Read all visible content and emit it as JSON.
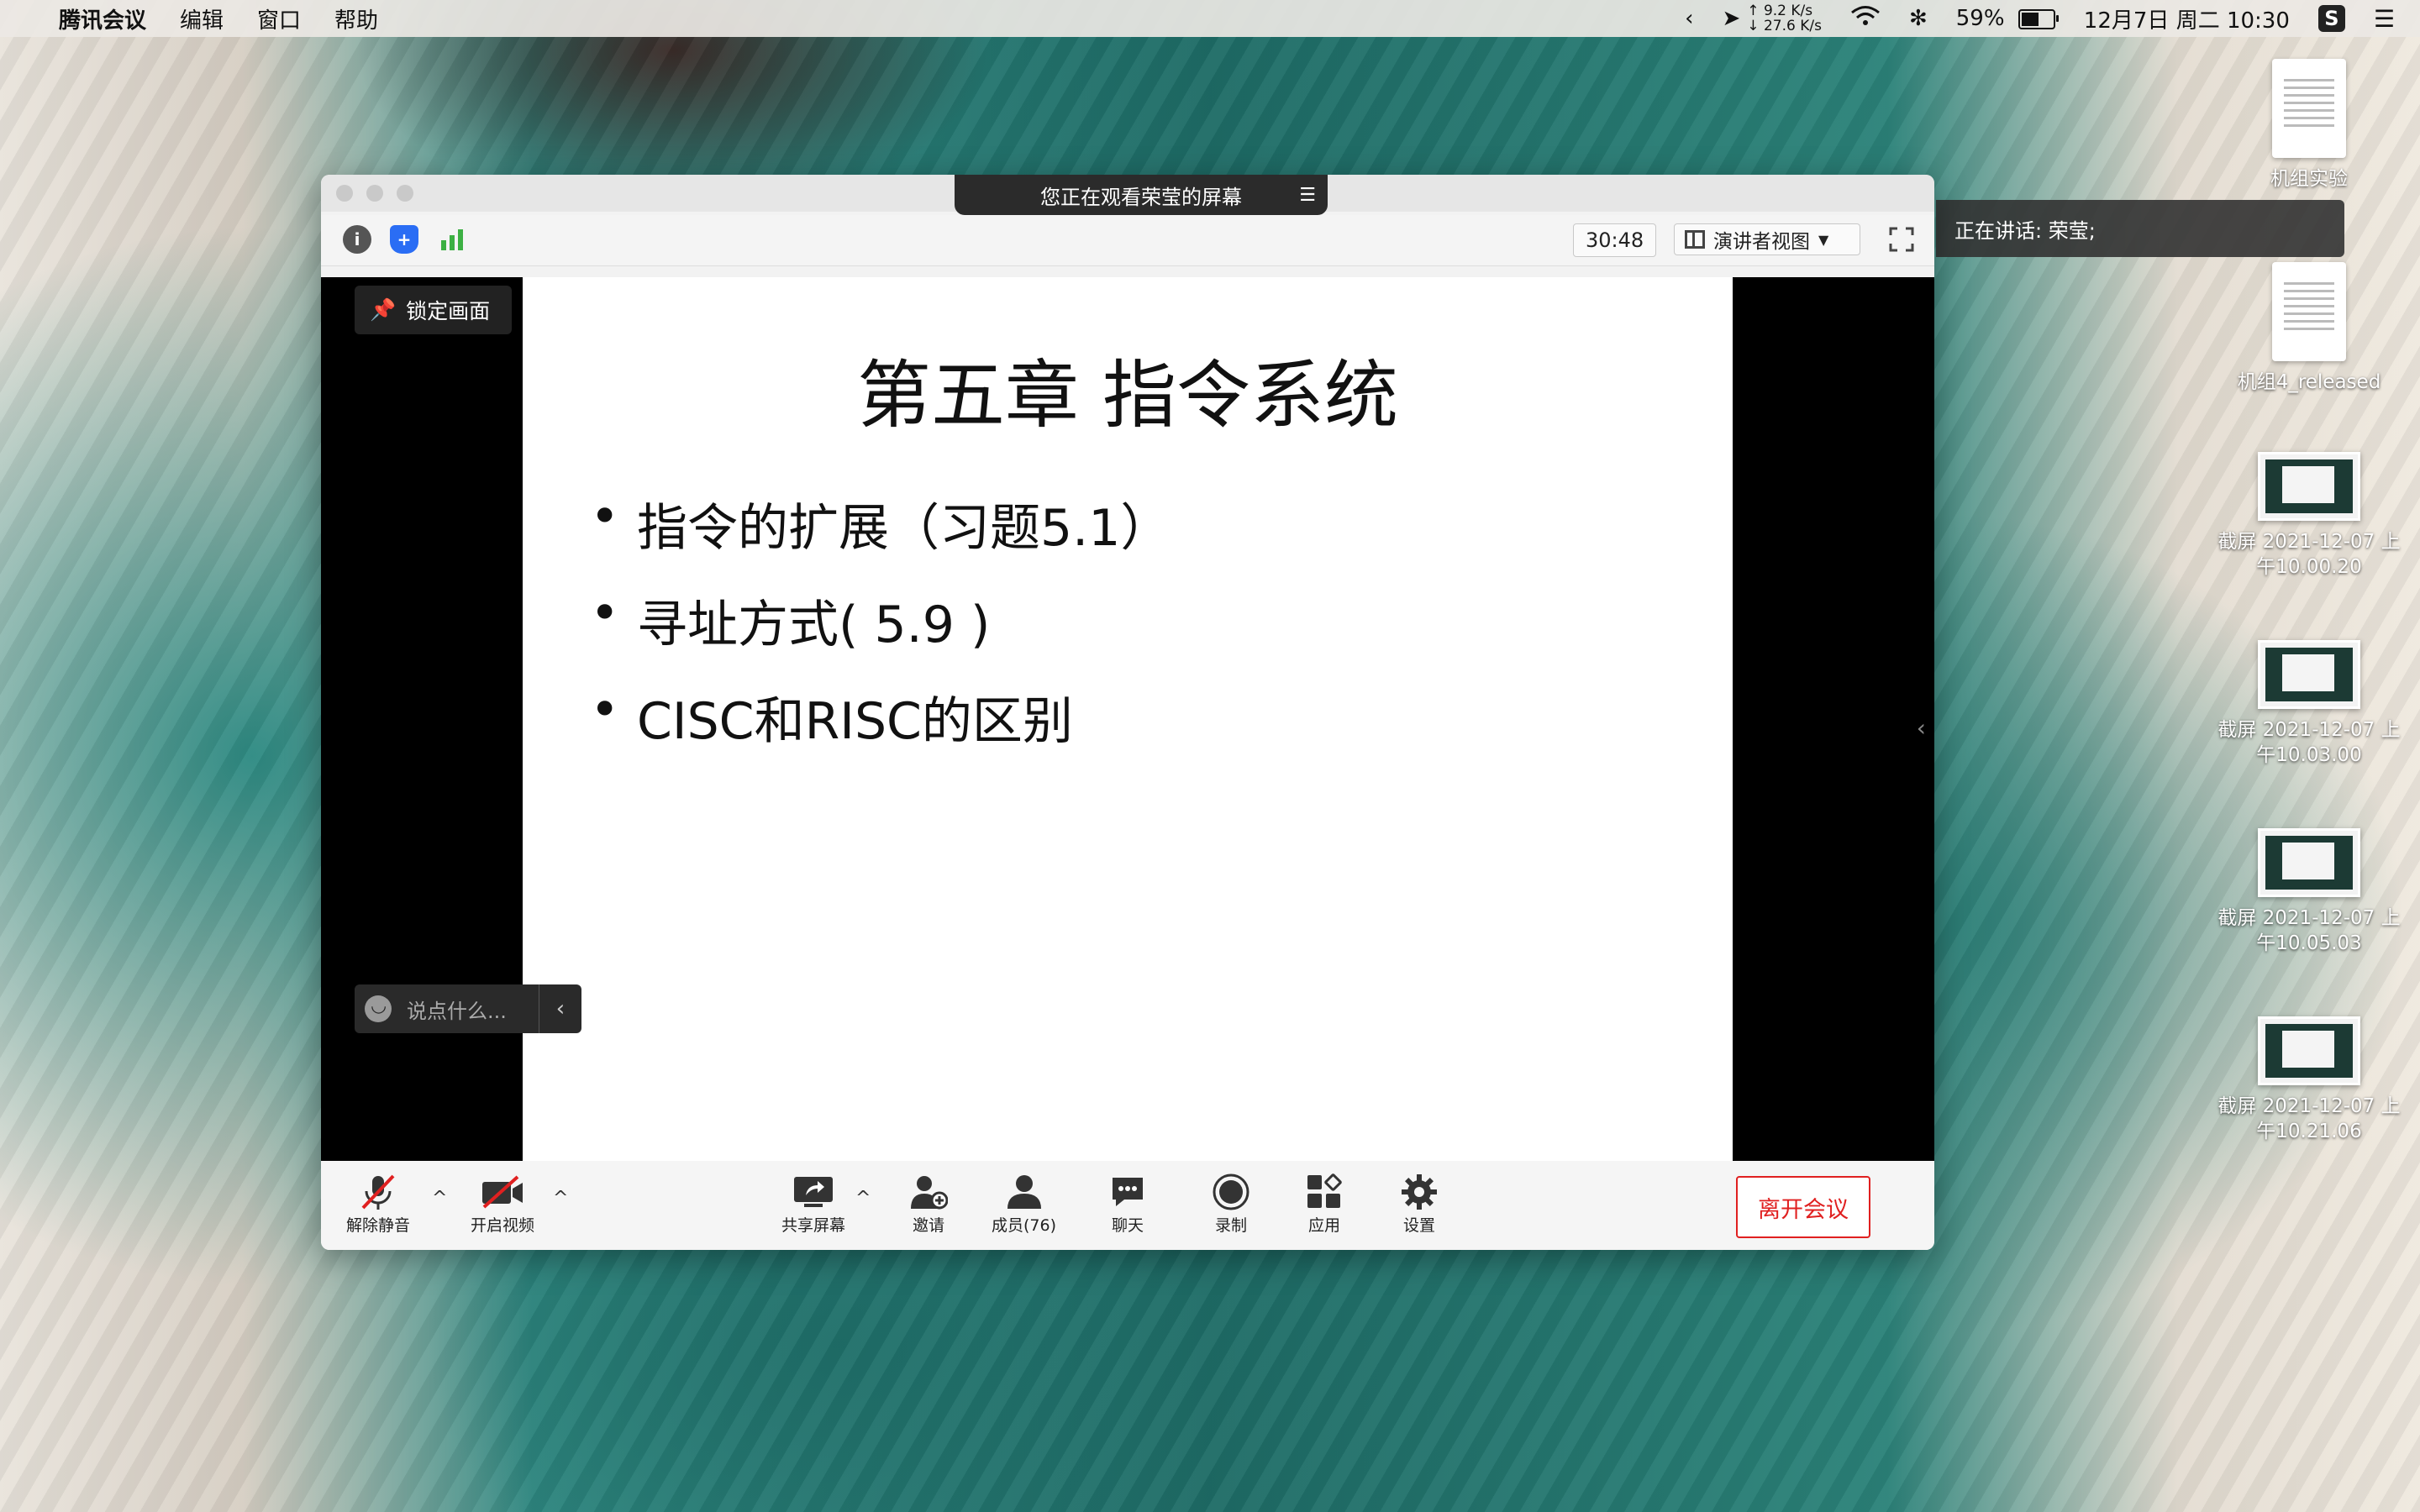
{
  "menubar": {
    "app": "腾讯会议",
    "items": [
      "编辑",
      "窗口",
      "帮助"
    ],
    "net_up": "9.2",
    "net_down": "27.6",
    "net_unit": "K/s",
    "battery": "59%",
    "battery_level": 0.59,
    "datetime": "12月7日 周二 10:30"
  },
  "window": {
    "title": "您正在观看荣莹的屏幕",
    "timer": "30:48",
    "view_mode": "演讲者视图",
    "lock_label": "锁定画面",
    "chat_placeholder": "说点什么...",
    "speaking": "正在讲话: 荣莹;"
  },
  "slide": {
    "title": "第五章 指令系统",
    "bullets": [
      "指令的扩展（习题5.1）",
      "寻址方式( 5.9 )",
      "CISC和RISC的区别"
    ]
  },
  "bottombar": {
    "unmute": "解除静音",
    "video": "开启视频",
    "share": "共享屏幕",
    "invite": "邀请",
    "members": "成员(76)",
    "chat": "聊天",
    "record": "录制",
    "apps": "应用",
    "settings": "设置",
    "leave": "离开会议"
  },
  "desktop": {
    "icons": [
      {
        "label": "机组实验",
        "kind": "doc"
      },
      {
        "label": "机组4_released",
        "kind": "doc"
      },
      {
        "label": "截屏 2021-12-07 上午10.00.20",
        "kind": "screenshot"
      },
      {
        "label": "截屏 2021-12-07 上午10.03.00",
        "kind": "screenshot"
      },
      {
        "label": "截屏 2021-12-07 上午10.05.03",
        "kind": "screenshot"
      },
      {
        "label": "截屏 2021-12-07 上午10.21.06",
        "kind": "screenshot"
      }
    ]
  },
  "colors": {
    "leave": "#e02020",
    "shield": "#2a6df4",
    "signal": "#3cb043"
  }
}
